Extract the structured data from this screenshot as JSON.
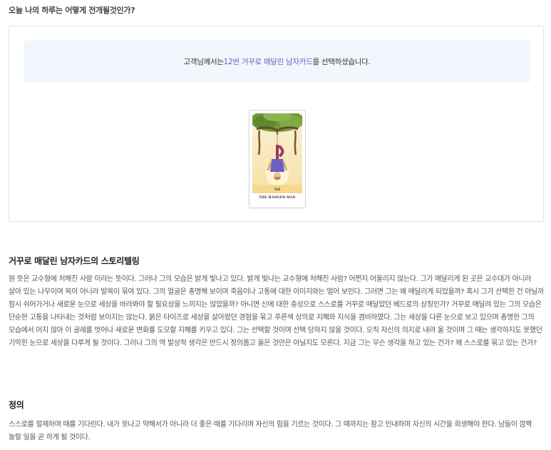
{
  "page": {
    "heading": "오늘 나의 하루는 어떻게 전개될것인가?"
  },
  "result": {
    "prefix": "고객님께서는 ",
    "card_name": "12번 거꾸로 매달린 남자카드",
    "suffix": "를 선택하셨습니다.",
    "highlight_color": "#6a5fc1",
    "notice_bg": "#f2f6fd"
  },
  "card": {
    "numeral": "XII",
    "caption": "THE HANGED MAN"
  },
  "storytelling": {
    "title": "거꾸로 매달린 남자카드의 스토리텔링",
    "body": "원 뜻은 교수형에 처해진 사람 이라는 뜻이다. 그러나 그의 모습은 밝게 빛나고 있다. 밝게 빛나는 교수형에 처해진 사람? 어쩐지 어울리지 않는다. 그가 매달리게 된 곳은 교수대가 아니라 살아 있는 나무이며 목이 아니라 발목이 묶여 있다. 그의 얼굴은 총명해 보이며 죽음이나 고통에 대한 이미지와는 멀어 보인다. 그러면 그는 왜 매달리게 되었을까? 혹시 그가 선택한 건 아닐까 잠시 쉬어가거나 새로운 눈으로 세상을 바라봐야 할 필요성을 느끼지는 않았을까? 아니면 신에 대한 충성으로 스스로를 거꾸로 매달았던 베드로의 상징인가? 거꾸로 매달려 있는 그의 모습은 단순한 고통을 나타내는 것처럼 보이지는 않는다. 붉은 타이즈로 세상을 살아왔던 경험을 묶고 푸른색 상의로 지혜와 지식을 겸비하였다. 그는 세상을 다른 눈으로 보고 있으며 총명한 그의 모습에서 머지 않아 이 굴레를 벗어나 새로운 변화를 도모할 지혜를 키우고 있다. 그는 선택할 것이며 선택 당하지 않을 것이다. 오직 자신의 의지로 내려 올 것이며 그 때는 생각하지도 못했던 기막힌 눈으로 세상을 다루게 될 것이다. 그러나 그의 역 발상적 생각은 반드시 정의롭고 옳은 것만은 아닐지도 모른다. 지금 그는 무슨 생각을 하고 있는 건가? 왜 스스로를 묶고 있는 건가?"
  },
  "definition": {
    "title": "정의",
    "body": "스스로를 절제하며 때를 기다린다. 내가 못나고 약해서가 아니라 더 좋은 때를 기다리며 자신의 힘을 기르는 것이다. 그 때까지는 참고 인내하며 자신의 시간을 희생해야 한다. 남들이 깜짝 놀랄 일을 곧 하게 될 것이다."
  }
}
